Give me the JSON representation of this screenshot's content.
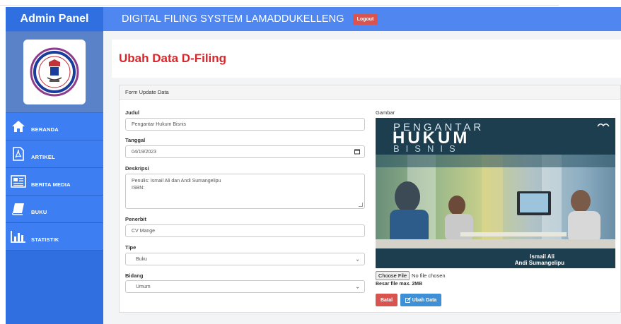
{
  "sidebar": {
    "title": "Admin Panel",
    "items": [
      {
        "label": "BERANDA",
        "icon": "home-icon"
      },
      {
        "label": "ARTIKEL",
        "icon": "pdf-icon"
      },
      {
        "label": "BERITA MEDIA",
        "icon": "newspaper-icon"
      },
      {
        "label": "BUKU",
        "icon": "book-icon"
      },
      {
        "label": "STATISTIK",
        "icon": "bar-chart-icon"
      }
    ]
  },
  "header": {
    "title": "DIGITAL FILING SYSTEM LAMADDUKELLENG",
    "logout_label": "Logout"
  },
  "page": {
    "title": "Ubah Data D-Filing"
  },
  "form": {
    "card_title": "Form Update Data",
    "judul_label": "Judul",
    "judul_value": "Pengantar Hukum Bisnis",
    "tanggal_label": "Tanggal",
    "tanggal_value": "04/19/2023",
    "deskripsi_label": "Deskripsi",
    "deskripsi_value": "Penulis: Ismail Ali dan Andi Sumangelipu\nISBN:",
    "penerbit_label": "Penerbit",
    "penerbit_value": "CV Mange",
    "tipe_label": "Tipe",
    "tipe_value": "Buku",
    "bidang_label": "Bidang",
    "bidang_value": "Umum",
    "gambar_label": "Gambar",
    "file_button": "Choose File",
    "file_status": "No file chosen",
    "file_note": "Besar file max. 2MB",
    "cancel_label": "Batal",
    "submit_label": "Ubah Data"
  },
  "cover": {
    "line1": "PENGANTAR",
    "line2": "HUKUM",
    "line3": "BISNIS",
    "author1": "Ismail Ali",
    "author2": "Andi Sumangelipu"
  },
  "colors": {
    "sidebar": "#2f6fe0",
    "header": "#4f86ef",
    "danger": "#d9534f",
    "primary": "#3e8fd6",
    "title_red": "#d9262a"
  }
}
